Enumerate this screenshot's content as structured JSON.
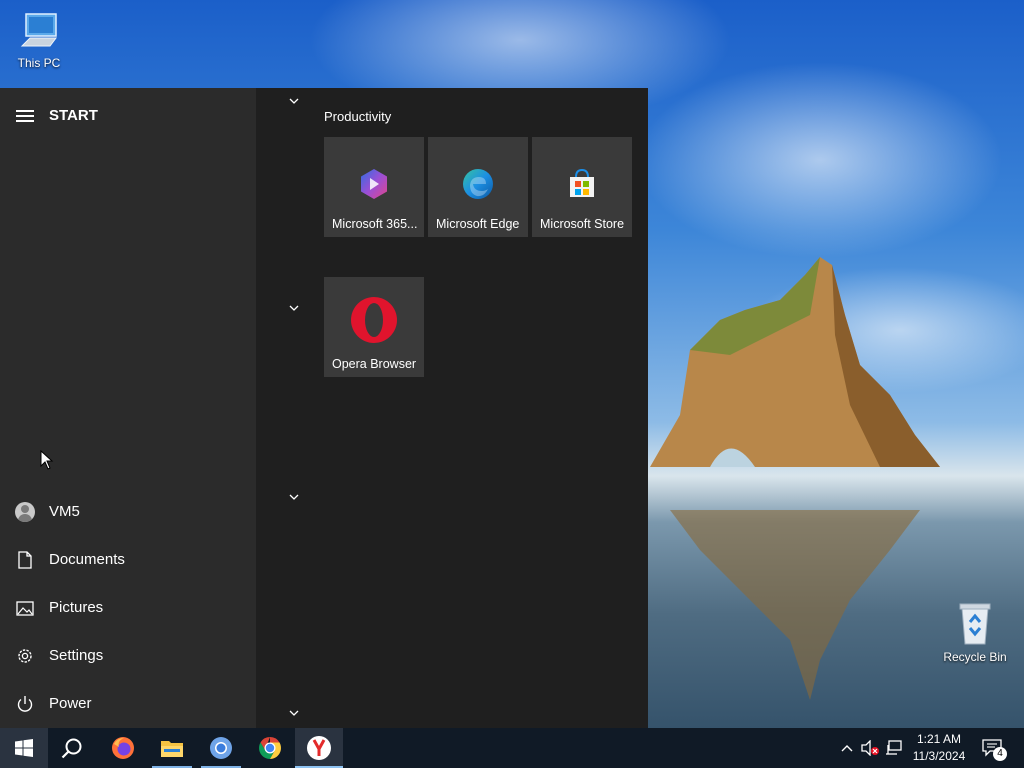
{
  "desktop": {
    "icons": [
      {
        "label": "This PC",
        "icon": "computer-icon"
      },
      {
        "label": "Recycle Bin",
        "icon": "recycle-bin-icon"
      }
    ]
  },
  "start_menu": {
    "title": "START",
    "user": {
      "label": "VM5",
      "icon": "user-avatar-icon"
    },
    "nav": [
      {
        "label": "Documents",
        "icon": "document-icon"
      },
      {
        "label": "Pictures",
        "icon": "pictures-icon"
      },
      {
        "label": "Settings",
        "icon": "gear-icon"
      },
      {
        "label": "Power",
        "icon": "power-icon"
      }
    ],
    "groups": [
      {
        "title": "Productivity",
        "tiles": [
          {
            "label": "Microsoft 365...",
            "icon": "microsoft-365-icon"
          },
          {
            "label": "Microsoft Edge",
            "icon": "edge-icon"
          },
          {
            "label": "Microsoft Store",
            "icon": "store-icon"
          }
        ]
      },
      {
        "title": "",
        "tiles": [
          {
            "label": "Opera Browser",
            "icon": "opera-icon"
          }
        ]
      }
    ]
  },
  "taskbar": {
    "apps": [
      {
        "name": "Start",
        "icon": "windows-logo-icon"
      },
      {
        "name": "Search",
        "icon": "search-icon"
      },
      {
        "name": "Firefox",
        "icon": "firefox-icon"
      },
      {
        "name": "File Explorer",
        "icon": "folder-icon"
      },
      {
        "name": "Chromium",
        "icon": "chromium-icon"
      },
      {
        "name": "Chrome",
        "icon": "chrome-icon"
      },
      {
        "name": "Yandex Browser",
        "icon": "yandex-icon"
      }
    ],
    "tray": {
      "time": "1:21 AM",
      "date": "11/3/2024",
      "notification_count": "4"
    }
  },
  "colors": {
    "start_left": "#2b2b2b",
    "start_right": "#1f1f1f",
    "tile": "#3a3a3a",
    "taskbar": "#101a26",
    "accent": "#8ec3f2"
  }
}
